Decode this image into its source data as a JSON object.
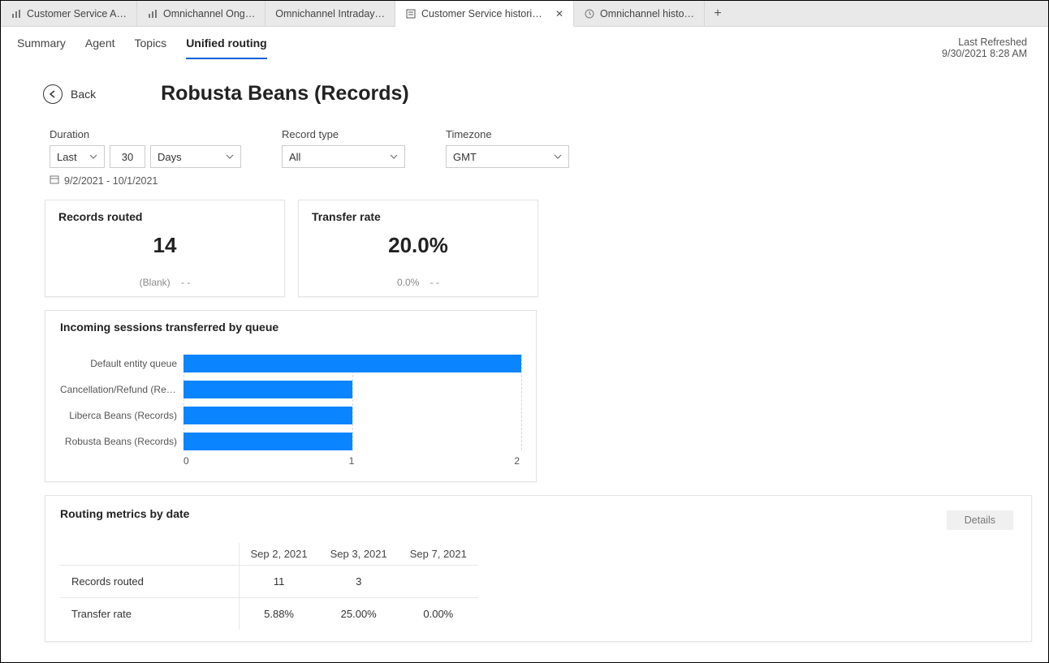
{
  "tabs": [
    {
      "label": "Customer Service A…"
    },
    {
      "label": "Omnichannel Ong…"
    },
    {
      "label": "Omnichannel Intraday…"
    },
    {
      "label": "Customer Service historic…",
      "active": true
    },
    {
      "label": "Omnichannel histo…"
    }
  ],
  "subnav": {
    "items": [
      "Summary",
      "Agent",
      "Topics",
      "Unified routing"
    ],
    "active": 3
  },
  "refreshed": {
    "label": "Last Refreshed",
    "value": "9/30/2021 8:28 AM"
  },
  "back_label": "Back",
  "page_title": "Robusta Beans (Records)",
  "filters": {
    "duration": {
      "label": "Duration",
      "period": "Last",
      "count": "30",
      "unit": "Days"
    },
    "record_type": {
      "label": "Record type",
      "value": "All"
    },
    "timezone": {
      "label": "Timezone",
      "value": "GMT"
    },
    "date_range": "9/2/2021 - 10/1/2021"
  },
  "kpis": {
    "records_routed": {
      "title": "Records routed",
      "value": "14",
      "foot_left": "(Blank)",
      "foot_right": "- -"
    },
    "transfer_rate": {
      "title": "Transfer rate",
      "value": "20.0%",
      "foot_left": "0.0%",
      "foot_right": "- -"
    }
  },
  "chart_data": {
    "type": "bar",
    "title": "Incoming sessions transferred by queue",
    "orientation": "horizontal",
    "categories": [
      "Default entity queue",
      "Cancellation/Refund (Rec…",
      "Liberca Beans (Records)",
      "Robusta Beans (Records)"
    ],
    "values": [
      2,
      1,
      1,
      1
    ],
    "xlim": [
      0,
      2
    ],
    "xticks": [
      0,
      1,
      2
    ],
    "xlabel": "",
    "ylabel": ""
  },
  "metrics": {
    "title": "Routing metrics by date",
    "details_label": "Details",
    "columns": [
      "Sep 2, 2021",
      "Sep 3, 2021",
      "Sep 7, 2021"
    ],
    "rows": [
      {
        "label": "Records routed",
        "cells": [
          "11",
          "3",
          ""
        ]
      },
      {
        "label": "Transfer rate",
        "cells": [
          "5.88%",
          "25.00%",
          "0.00%"
        ]
      }
    ]
  }
}
